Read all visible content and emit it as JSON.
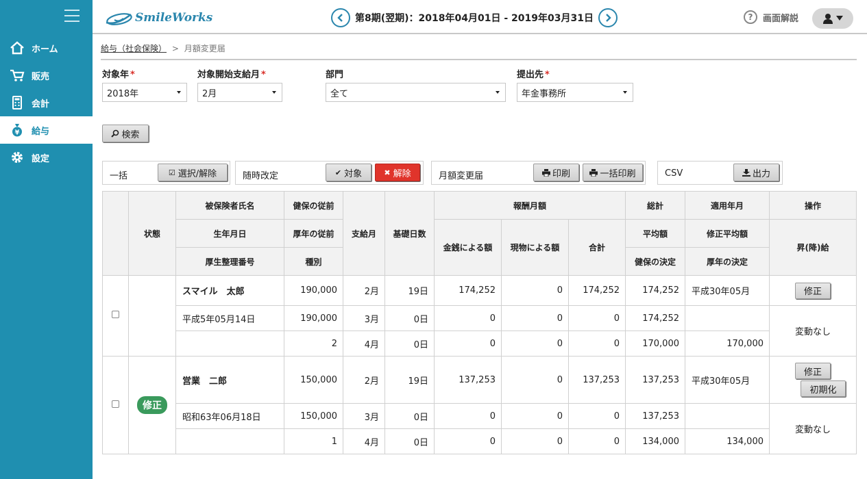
{
  "sidebar": {
    "items": [
      {
        "label": "ホーム",
        "icon": "home-icon"
      },
      {
        "label": "販売",
        "icon": "cart-icon"
      },
      {
        "label": "会計",
        "icon": "calculator-icon"
      },
      {
        "label": "給与",
        "icon": "yen-bag-icon"
      },
      {
        "label": "設定",
        "icon": "gear-icon"
      }
    ],
    "active": "給与"
  },
  "header": {
    "logo": "SmileWorks",
    "period": "第8期(翌期)：2018年04月01日 - 2019年03月31日",
    "help": "画面解説"
  },
  "breadcrumb": {
    "parent": "給与（社会保険）",
    "sep": ">",
    "current": "月額変更届"
  },
  "filters": {
    "year": {
      "label": "対象年",
      "value": "2018年"
    },
    "month": {
      "label": "対象開始支給月",
      "value": "2月"
    },
    "dept": {
      "label": "部門",
      "value": "全て"
    },
    "dest": {
      "label": "提出先",
      "value": "年金事務所"
    },
    "required_mark": "*"
  },
  "search_button": "検索",
  "actions": {
    "bulk": {
      "label": "一括",
      "button": "選択/解除"
    },
    "revision": {
      "label": "随時改定",
      "target": "対象",
      "cancel": "解除"
    },
    "form": {
      "label": "月額変更届",
      "print": "印刷",
      "bulk_print": "一括印刷"
    },
    "csv": {
      "label": "CSV",
      "output": "出力"
    }
  },
  "table": {
    "headers": {
      "status": "状態",
      "name": "被保険者氏名",
      "birth": "生年月日",
      "number": "厚生整理番号",
      "kenpo_grade": "健保の従前",
      "kosei_grade": "厚年の従前",
      "kind": "種別",
      "pay_month": "支給月",
      "days": "基礎日数",
      "remuneration": "報酬月額",
      "cash": "金銭による額",
      "inkind": "現物による額",
      "total": "合計",
      "sum": "総計",
      "avg": "平均額",
      "kenpo_decision": "健保の決定",
      "apply_month": "適用年月",
      "revised_avg": "修正平均額",
      "kosei_decision": "厚年の決定",
      "ops": "操作",
      "updown": "昇(降)給"
    },
    "employees": [
      {
        "name": "スマイル　太郎",
        "birth": "平成5年05月14日",
        "number": "",
        "kind": "2",
        "status": "",
        "prev_kenpo": "190,000",
        "prev_kosei": "190,000",
        "rows": [
          {
            "month": "2月",
            "days": "19日",
            "cash": "174,252",
            "inkind": "0",
            "total": "174,252",
            "sum": "174,252"
          },
          {
            "month": "3月",
            "days": "0日",
            "cash": "0",
            "inkind": "0",
            "total": "0",
            "sum": "174,252"
          },
          {
            "month": "4月",
            "days": "0日",
            "cash": "0",
            "inkind": "0",
            "total": "0",
            "sum": "170,000"
          }
        ],
        "apply_month": "平成30年05月",
        "revised_avg": "",
        "kosei_decision": "170,000",
        "ops": [
          "修正"
        ],
        "updown": "変動なし"
      },
      {
        "name": "営業　二郎",
        "birth": "昭和63年06月18日",
        "number": "",
        "kind": "1",
        "status": "修正",
        "prev_kenpo": "150,000",
        "prev_kosei": "150,000",
        "rows": [
          {
            "month": "2月",
            "days": "19日",
            "cash": "137,253",
            "inkind": "0",
            "total": "137,253",
            "sum": "137,253"
          },
          {
            "month": "3月",
            "days": "0日",
            "cash": "0",
            "inkind": "0",
            "total": "0",
            "sum": "137,253"
          },
          {
            "month": "4月",
            "days": "0日",
            "cash": "0",
            "inkind": "0",
            "total": "0",
            "sum": "134,000"
          }
        ],
        "apply_month": "平成30年05月",
        "revised_avg": "",
        "kosei_decision": "134,000",
        "ops": [
          "修正",
          "初期化"
        ],
        "updown": "変動なし"
      }
    ]
  }
}
